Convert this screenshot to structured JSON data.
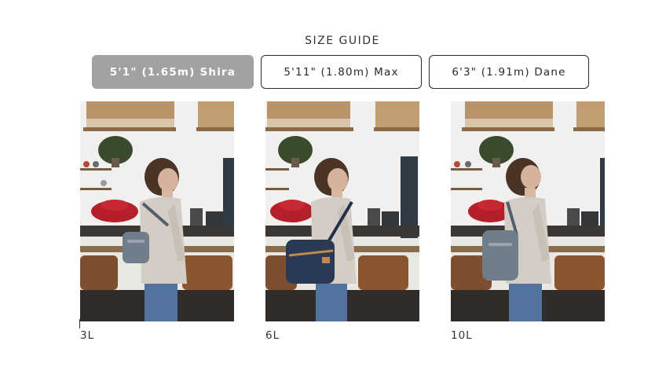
{
  "size_guide": {
    "title": "SIZE GUIDE",
    "tabs": [
      {
        "label": "5'1\" (1.65m) Shira",
        "active": true
      },
      {
        "label": "5'11\" (1.80m) Max",
        "active": false
      },
      {
        "label": "6'3\" (1.91m) Dane",
        "active": false
      }
    ],
    "photos": [
      {
        "caption": "3L",
        "bag": "small-gray-sling"
      },
      {
        "caption": "6L",
        "bag": "navy-sling"
      },
      {
        "caption": "10L",
        "bag": "gray-sling-large"
      }
    ]
  },
  "colors": {
    "active_tab": "#a1a1a1",
    "tab_border": "#2b2b2b",
    "navy_bag": "#2a3a55",
    "gray_bag": "#6f7e8a"
  }
}
